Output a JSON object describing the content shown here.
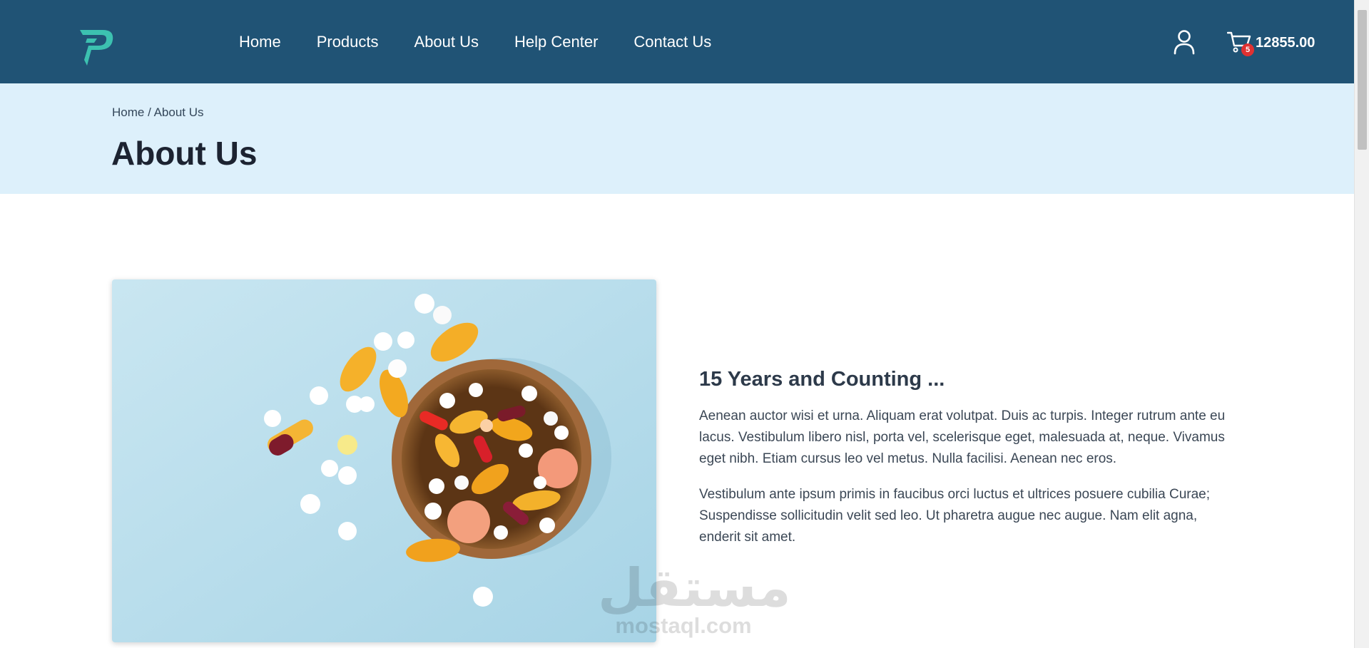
{
  "header": {
    "logo_icon": "letter-p-logo-icon",
    "nav": [
      "Home",
      "Products",
      "About Us",
      "Help Center",
      "Contact Us"
    ],
    "user_icon": "user-icon",
    "cart": {
      "icon": "cart-icon",
      "count": "5",
      "total": "12855.00"
    }
  },
  "page_header": {
    "breadcrumb": "Home / About Us",
    "title": "About Us"
  },
  "about": {
    "image_description": "bowl-of-pills-photo",
    "heading": "15 Years and Counting ...",
    "paragraphs": [
      "Aenean auctor wisi et urna. Aliquam erat volutpat. Duis ac turpis. Integer rutrum ante eu lacus. Vestibulum libero nisl, porta vel, scelerisque eget, malesuada at, neque. Vivamus eget nibh. Etiam cursus leo vel metus. Nulla facilisi. Aenean nec eros.",
      "Vestibulum ante ipsum primis in faucibus orci luctus et ultrices posuere cubilia Curae; Suspendisse sollicitudin velit sed leo. Ut pharetra augue nec augue. Nam elit agna, enderit sit amet."
    ]
  },
  "watermark": {
    "arabic": "مستقل",
    "latin": "mostaql.com"
  },
  "colors": {
    "navbar": "#205375",
    "band": "#ddf0fb",
    "logo": "#3cc1b0",
    "badge": "#e03131"
  }
}
